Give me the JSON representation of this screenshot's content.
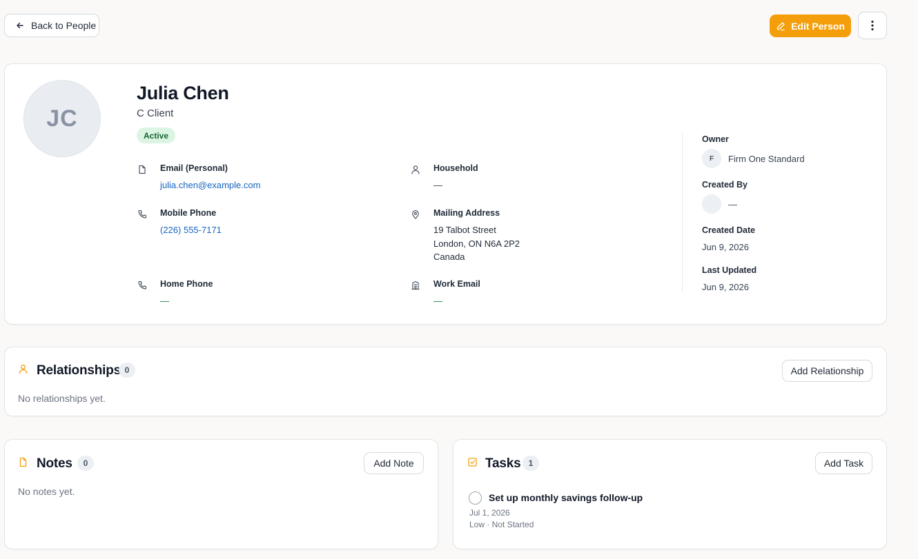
{
  "header": {
    "back_label": "Back to People",
    "edit_label": "Edit Person"
  },
  "profile": {
    "initials": "JC",
    "name": "Julia Chen",
    "type": "C Client",
    "status": "Active",
    "fields": {
      "email_personal": {
        "label": "Email (Personal)",
        "value": "julia.chen@example.com"
      },
      "household": {
        "label": "Household",
        "value": "—"
      },
      "mobile_phone": {
        "label": "Mobile Phone",
        "value": "(226) 555-7171"
      },
      "mailing_address": {
        "label": "Mailing Address",
        "lines": [
          "19 Talbot Street",
          "London, ON N6A 2P2",
          "Canada"
        ]
      },
      "home_phone": {
        "label": "Home Phone",
        "value": "—"
      },
      "work_email": {
        "label": "Work Email",
        "value": "—"
      }
    },
    "meta": {
      "owner": {
        "label": "Owner",
        "initial": "F",
        "value": "Firm One Standard"
      },
      "created_by": {
        "label": "Created By",
        "value": "—"
      },
      "created_date": {
        "label": "Created Date",
        "value": "Jun 9, 2026"
      },
      "last_updated": {
        "label": "Last Updated",
        "value": "Jun 9, 2026"
      }
    }
  },
  "relationships": {
    "title": "Relationships",
    "count": "0",
    "add_label": "Add Relationship",
    "empty": "No relationships yet."
  },
  "notes": {
    "title": "Notes",
    "count": "0",
    "add_label": "Add Note",
    "empty": "No notes yet."
  },
  "tasks": {
    "title": "Tasks",
    "count": "1",
    "add_label": "Add Task",
    "items": [
      {
        "title": "Set up monthly savings follow-up",
        "date": "Jul 1, 2026",
        "meta": "Low · Not Started"
      }
    ]
  },
  "colors": {
    "accent": "#f59e0b",
    "link": "#1565c0",
    "status_bg": "#dcf5e3",
    "status_text": "#166534"
  }
}
